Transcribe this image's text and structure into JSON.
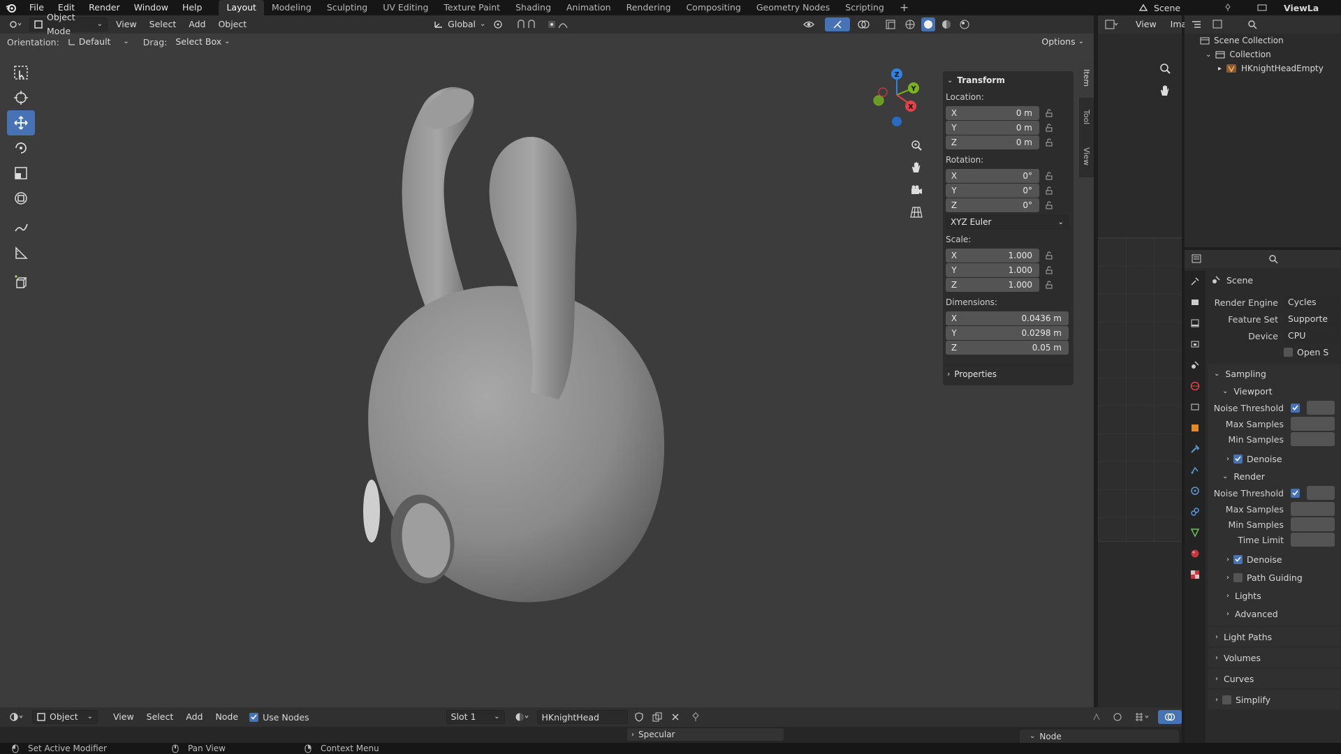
{
  "menubar": {
    "items": [
      "File",
      "Edit",
      "Render",
      "Window",
      "Help"
    ],
    "workspaces": [
      "Layout",
      "Modeling",
      "Sculpting",
      "UV Editing",
      "Texture Paint",
      "Shading",
      "Animation",
      "Rendering",
      "Compositing",
      "Geometry Nodes",
      "Scripting"
    ],
    "active_workspace": "Layout",
    "scene": "Scene",
    "view_layer": "ViewLa"
  },
  "viewport_header": {
    "mode": "Object Mode",
    "menus": [
      "View",
      "Select",
      "Add",
      "Object"
    ],
    "transform_orientation": "Global",
    "orientation_label": "Orientation:",
    "orientation_value": "Default",
    "drag_label": "Drag:",
    "drag_value": "Select Box",
    "options": "Options"
  },
  "side_tabs": [
    "Item",
    "Tool",
    "View"
  ],
  "transform_panel": {
    "title": "Transform",
    "location_label": "Location:",
    "location": [
      {
        "axis": "X",
        "value": "0 m"
      },
      {
        "axis": "Y",
        "value": "0 m"
      },
      {
        "axis": "Z",
        "value": "0 m"
      }
    ],
    "rotation_label": "Rotation:",
    "rotation": [
      {
        "axis": "X",
        "value": "0°"
      },
      {
        "axis": "Y",
        "value": "0°"
      },
      {
        "axis": "Z",
        "value": "0°"
      }
    ],
    "rotation_mode": "XYZ Euler",
    "scale_label": "Scale:",
    "scale": [
      {
        "axis": "X",
        "value": "1.000"
      },
      {
        "axis": "Y",
        "value": "1.000"
      },
      {
        "axis": "Z",
        "value": "1.000"
      }
    ],
    "dimensions_label": "Dimensions:",
    "dimensions": [
      {
        "axis": "X",
        "value": "0.0436 m"
      },
      {
        "axis": "Y",
        "value": "0.0298 m"
      },
      {
        "axis": "Z",
        "value": "0.05 m"
      }
    ],
    "properties_label": "Properties"
  },
  "gizmo": {
    "x": "X",
    "y": "Y",
    "z": "Z"
  },
  "image_editor": {
    "view": "View",
    "image": "Ima"
  },
  "outliner": {
    "scene_collection": "Scene Collection",
    "collection": "Collection",
    "object": "HKnightHeadEmpty"
  },
  "properties": {
    "context": "Scene",
    "render_engine_label": "Render Engine",
    "render_engine": "Cycles",
    "feature_set_label": "Feature Set",
    "feature_set": "Supporte",
    "device_label": "Device",
    "device": "CPU",
    "open_shading": "Open S",
    "sampling": "Sampling",
    "viewport": "Viewport",
    "noise_threshold": "Noise Threshold",
    "max_samples": "Max Samples",
    "min_samples": "Min Samples",
    "denoise": "Denoise",
    "render": "Render",
    "time_limit": "Time Limit",
    "path_guiding": "Path Guiding",
    "lights": "Lights",
    "advanced": "Advanced",
    "light_paths": "Light Paths",
    "volumes": "Volumes",
    "curves": "Curves",
    "simplify": "Simplify"
  },
  "node_header": {
    "type": "Object",
    "menus": [
      "View",
      "Select",
      "Add",
      "Node"
    ],
    "use_nodes": "Use Nodes",
    "slot": "Slot 1",
    "material": "HKnightHead",
    "specular": "Specular",
    "node": "Node"
  },
  "statusbar": {
    "items": [
      "Set Active Modifier",
      "Pan View",
      "Context Menu"
    ]
  },
  "colors": {
    "accent": "#4772b3",
    "viewport_bg": "#3c3c3c",
    "header_bg": "#303030",
    "x_axis": "#e0434a",
    "y_axis": "#7bb21e",
    "z_axis": "#2f83e4"
  }
}
